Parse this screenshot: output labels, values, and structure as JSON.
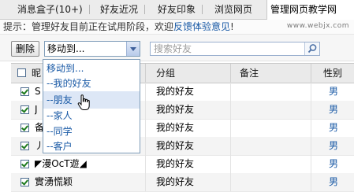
{
  "tabs": [
    {
      "label": "消息盒子(10+)"
    },
    {
      "label": "好友近况"
    },
    {
      "label": "好友印象"
    },
    {
      "label": "浏览网页"
    },
    {
      "label": "管理网页教学网"
    }
  ],
  "watermark": {
    "url": "www.webjx.com"
  },
  "notice": {
    "prefix": "提示：管理好友目前正在试用阶段，欢迎",
    "link": "反馈体验意见",
    "suffix": "!"
  },
  "toolbar": {
    "delete_label": "删除",
    "move_select_value": "移动到...",
    "search_placeholder": "搜索好友"
  },
  "move_options": [
    {
      "label": "移动到..."
    },
    {
      "label": "--我的好友"
    },
    {
      "label": "--朋友"
    },
    {
      "label": "--家人"
    },
    {
      "label": "--同学"
    },
    {
      "label": "--客户"
    }
  ],
  "table": {
    "headers": {
      "name": "昵",
      "group": "分组",
      "note": "备注",
      "gender": "性别"
    },
    "rows": [
      {
        "name": "S",
        "group": "我的好友",
        "note": "",
        "gender": "男"
      },
      {
        "name": "J",
        "group": "我的好友",
        "note": "",
        "gender": "男"
      },
      {
        "name": "备",
        "group": "我的好友",
        "note": "",
        "gender": "男"
      },
      {
        "name": "丿",
        "group": "我的好友",
        "note": "",
        "gender": "男"
      },
      {
        "name": "◤漫OcT遊◢",
        "group": "我的好友",
        "note": "",
        "gender": "男"
      },
      {
        "name": "實湧慌颖",
        "group": "我的好友",
        "note": "",
        "gender": "男"
      }
    ]
  },
  "colors": {
    "accent": "#1a5aa6",
    "check": "#1d7a1d",
    "hover": "#dde7f6"
  }
}
